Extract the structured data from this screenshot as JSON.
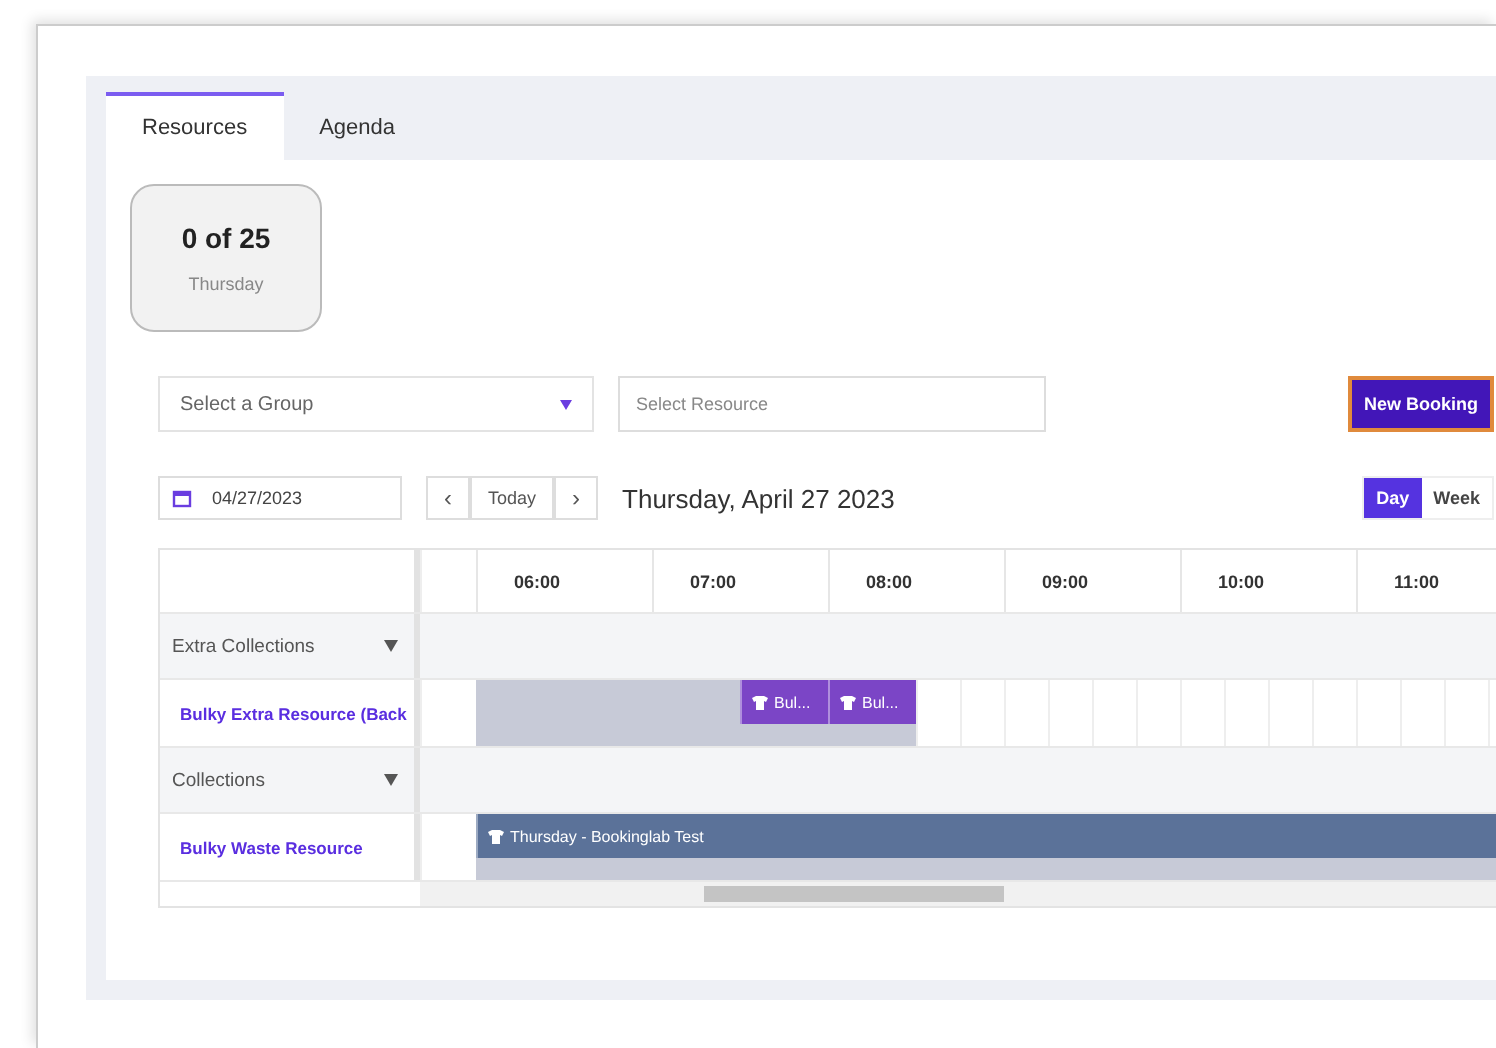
{
  "tabs": [
    {
      "label": "Resources",
      "selected": true
    },
    {
      "label": "Agenda",
      "selected": false
    }
  ],
  "summary_card": {
    "count": "0 of 25",
    "day": "Thursday"
  },
  "group_select": {
    "placeholder": "Select a Group"
  },
  "resource_field": {
    "placeholder": "Select Resource"
  },
  "new_booking_button": "New Booking",
  "date_field": {
    "value": "04/27/2023"
  },
  "nav": {
    "prev": "‹",
    "today": "Today",
    "next": "›"
  },
  "date_heading": "Thursday, April 27 2023",
  "view_tabs": [
    {
      "label": "Day",
      "selected": true
    },
    {
      "label": "Week",
      "selected": false
    }
  ],
  "schedule": {
    "hours": [
      "06:00",
      "07:00",
      "08:00",
      "09:00",
      "10:00",
      "11:00"
    ],
    "rows": [
      {
        "kind": "group",
        "label": "Extra Collections",
        "expanded": true
      },
      {
        "kind": "resource",
        "label": "Bulky Extra Resource (Back",
        "events": [
          {
            "title": "Bul...",
            "color": "#7b45c6"
          },
          {
            "title": "Bul...",
            "color": "#7b45c6"
          }
        ]
      },
      {
        "kind": "group",
        "label": "Collections",
        "expanded": true
      },
      {
        "kind": "resource",
        "label": "Bulky Waste Resource",
        "events": [
          {
            "title": "Thursday - Bookinglab Test",
            "color": "#5b7299"
          }
        ]
      }
    ]
  }
}
